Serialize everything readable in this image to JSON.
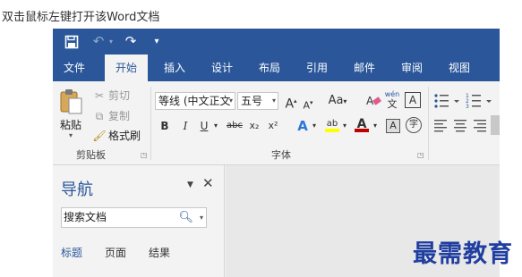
{
  "caption": "双击鼠标左键打开该Word文档",
  "quick_access": {
    "save_icon": "save-icon",
    "undo_icon": "undo-icon",
    "redo_icon": "redo-icon",
    "customize_icon": "customize-qat-icon"
  },
  "tabs": [
    {
      "label": "文件"
    },
    {
      "label": "开始"
    },
    {
      "label": "插入"
    },
    {
      "label": "设计"
    },
    {
      "label": "布局"
    },
    {
      "label": "引用"
    },
    {
      "label": "邮件"
    },
    {
      "label": "审阅"
    },
    {
      "label": "视图"
    }
  ],
  "clipboard": {
    "paste": "粘贴",
    "cut": "剪切",
    "copy": "复制",
    "format_painter": "格式刷",
    "group_label": "剪贴板"
  },
  "font": {
    "font_name": "等线 (中文正文",
    "font_size": "五号",
    "group_label": "字体",
    "phonetic_label": "wén",
    "phonetic_char": "文",
    "boxed_char": "A",
    "enclosed_char": "字",
    "grow": "A",
    "shrink": "A",
    "change_case": "Aa",
    "bold": "B",
    "italic": "I",
    "underline": "U",
    "strike": "abc",
    "subscript": "x₂",
    "superscript": "x²",
    "effects": "A",
    "highlight": "ab",
    "font_color": "A"
  },
  "nav": {
    "title": "导航",
    "search_placeholder": "搜索文档",
    "tabs": [
      {
        "label": "标题"
      },
      {
        "label": "页面"
      },
      {
        "label": "结果"
      }
    ]
  },
  "watermark": "最需教育",
  "colors": {
    "accent": "#2b579a",
    "highlight": "#ffff00",
    "font_color": "#c00000"
  }
}
